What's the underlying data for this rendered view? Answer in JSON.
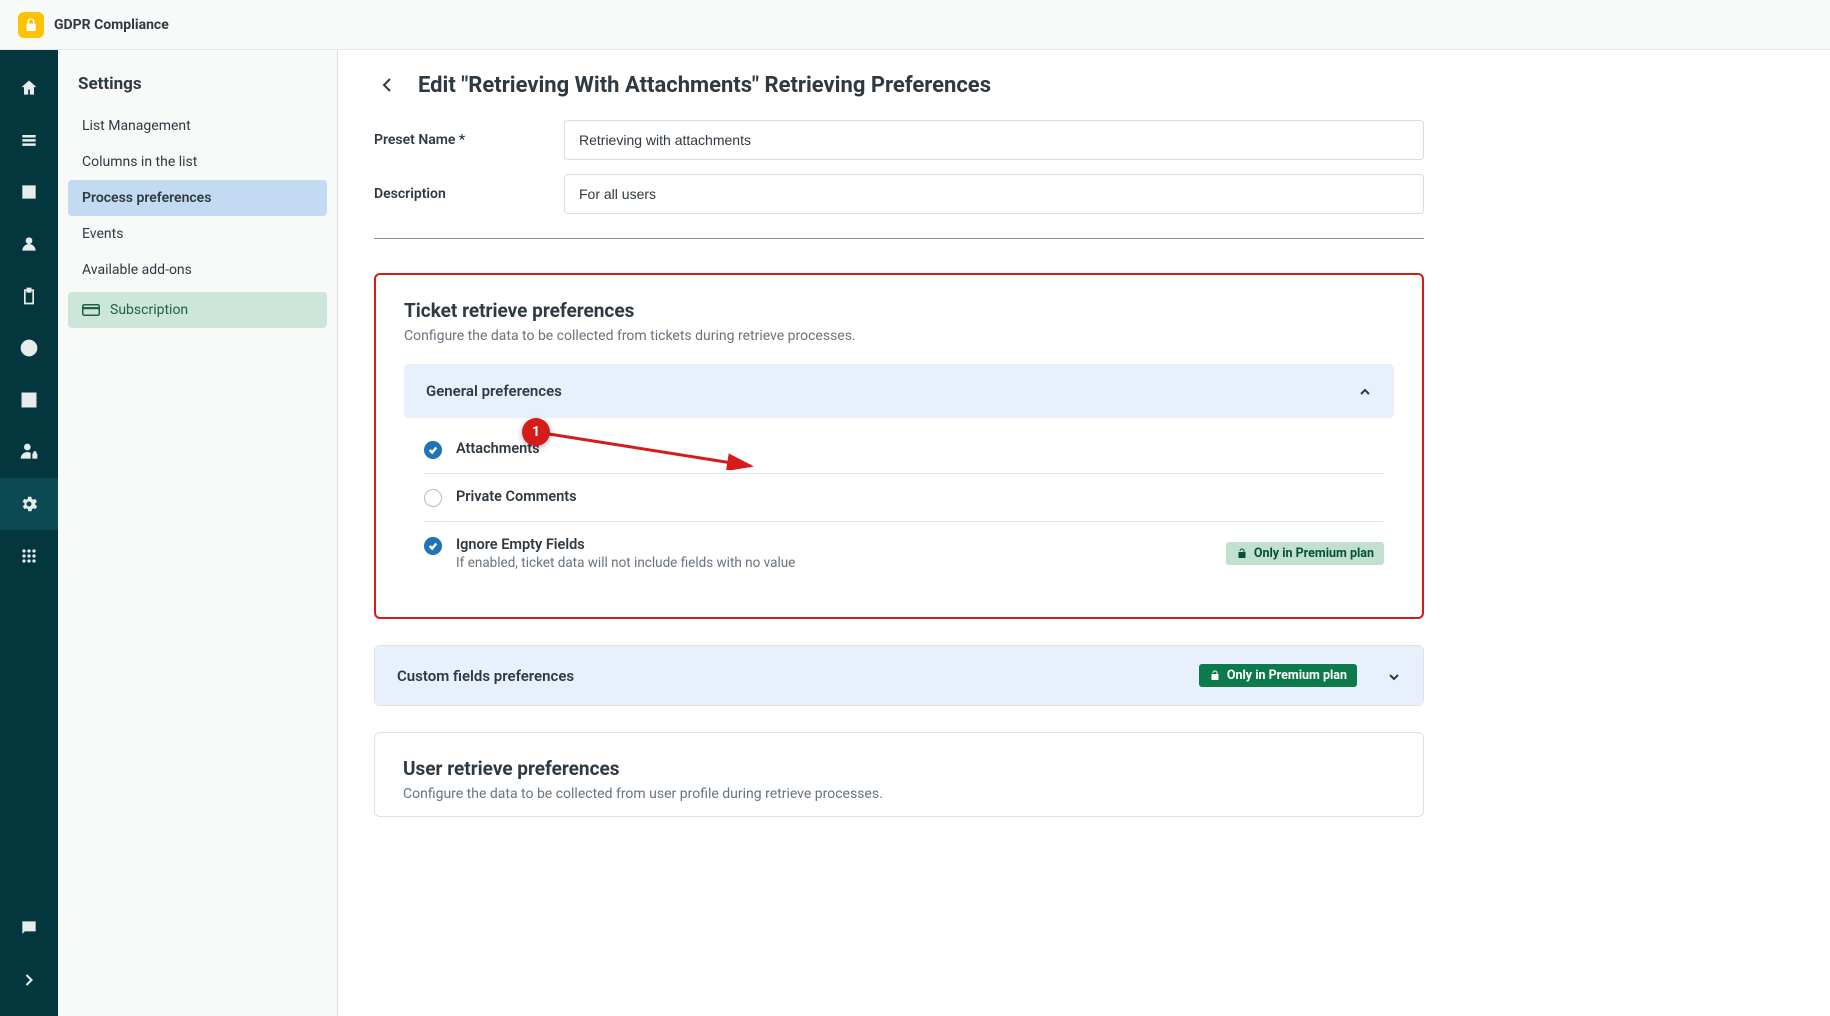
{
  "header": {
    "app_title": "GDPR Compliance"
  },
  "sidepanel": {
    "title": "Settings",
    "items": {
      "list_management": "List Management",
      "columns": "Columns in the list",
      "process_prefs": "Process preferences",
      "events": "Events",
      "addons": "Available add-ons",
      "subscription": "Subscription"
    }
  },
  "main": {
    "page_title": "Edit \"Retrieving With Attachments\" Retrieving Preferences",
    "preset_name_label": "Preset Name *",
    "preset_name_value": "Retrieving with attachments",
    "description_label": "Description",
    "description_value": "For all users",
    "ticket_section": {
      "title": "Ticket retrieve preferences",
      "subtitle": "Configure the data to be collected from tickets during retrieve processes.",
      "general_prefs_title": "General preferences",
      "attachments_label": "Attachments",
      "private_comments_label": "Private Comments",
      "ignore_empty_label": "Ignore Empty Fields",
      "ignore_empty_helper": "If enabled, ticket data will not include fields with no value",
      "premium_badge": "Only in Premium plan",
      "custom_fields_title": "Custom fields preferences",
      "custom_fields_premium": "Only in Premium plan"
    },
    "user_section": {
      "title": "User retrieve preferences",
      "subtitle": "Configure the data to be collected from user profile during retrieve processes."
    }
  },
  "annotation": {
    "number": "1"
  }
}
